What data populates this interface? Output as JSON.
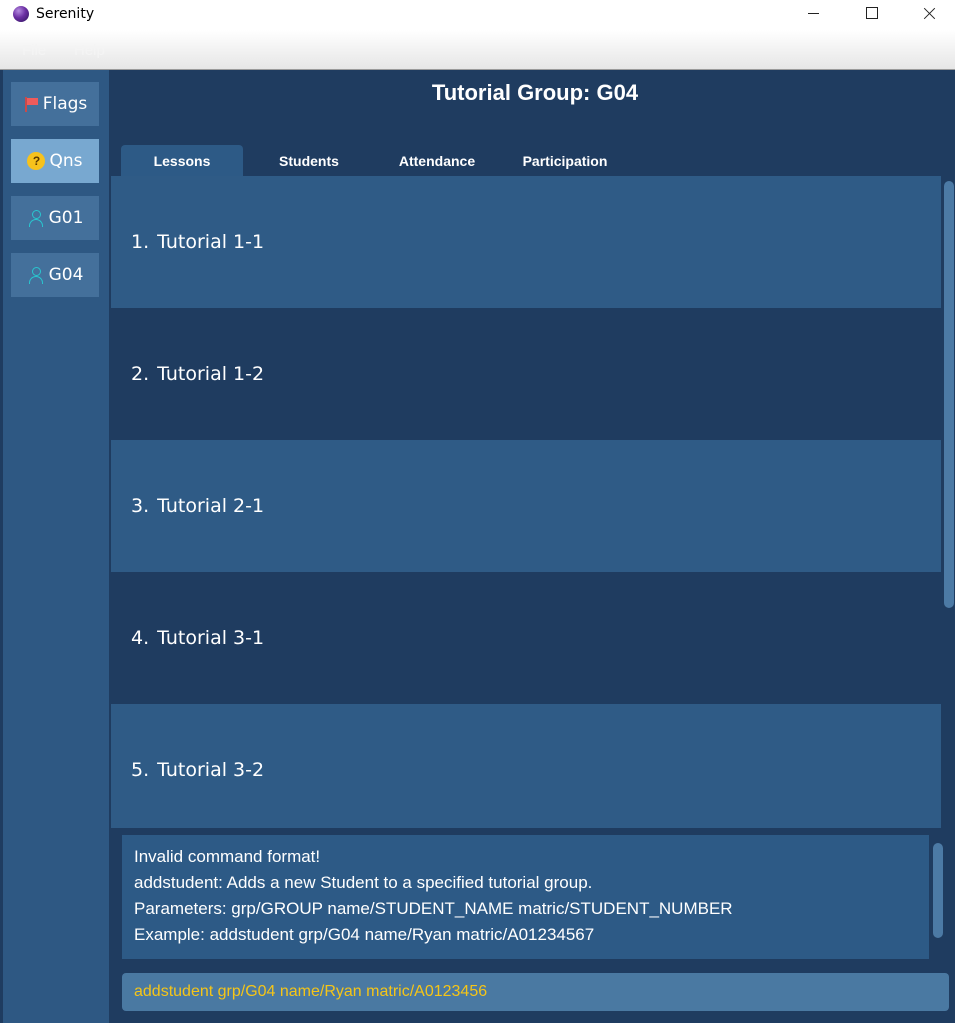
{
  "window": {
    "title": "Serenity"
  },
  "menu": {
    "file": "File",
    "help": "Help"
  },
  "sidebar": {
    "items": [
      {
        "label": "Flags",
        "icon": "flag-icon"
      },
      {
        "label": "Qns",
        "icon": "question-icon",
        "icon_glyph": "?"
      },
      {
        "label": "G01",
        "icon": "person-icon"
      },
      {
        "label": "G04",
        "icon": "person-icon"
      }
    ]
  },
  "header": {
    "title": "Tutorial Group: G04"
  },
  "tabs": [
    {
      "label": "Lessons",
      "active": true
    },
    {
      "label": "Students",
      "active": false
    },
    {
      "label": "Attendance",
      "active": false
    },
    {
      "label": "Participation",
      "active": false
    }
  ],
  "lessons": [
    {
      "index": "1.",
      "name": "Tutorial 1-1"
    },
    {
      "index": "2.",
      "name": "Tutorial 1-2"
    },
    {
      "index": "3.",
      "name": "Tutorial 2-1"
    },
    {
      "index": "4.",
      "name": "Tutorial 3-1"
    },
    {
      "index": "5.",
      "name": "Tutorial 3-2"
    }
  ],
  "result": {
    "lines": [
      "Invalid command format!",
      "addstudent: Adds a new Student to a specified tutorial group.",
      "Parameters: grp/GROUP name/STUDENT_NAME matric/STUDENT_NUMBER",
      "Example: addstudent grp/G04 name/Ryan matric/A01234567"
    ]
  },
  "command": {
    "value": "addstudent grp/G04 name/Ryan matric/A0123456"
  },
  "colors": {
    "background": "#1f3c60",
    "sidebar": "#2e5883",
    "row_odd": "#2f5b86",
    "command_text": "#f5c518"
  }
}
